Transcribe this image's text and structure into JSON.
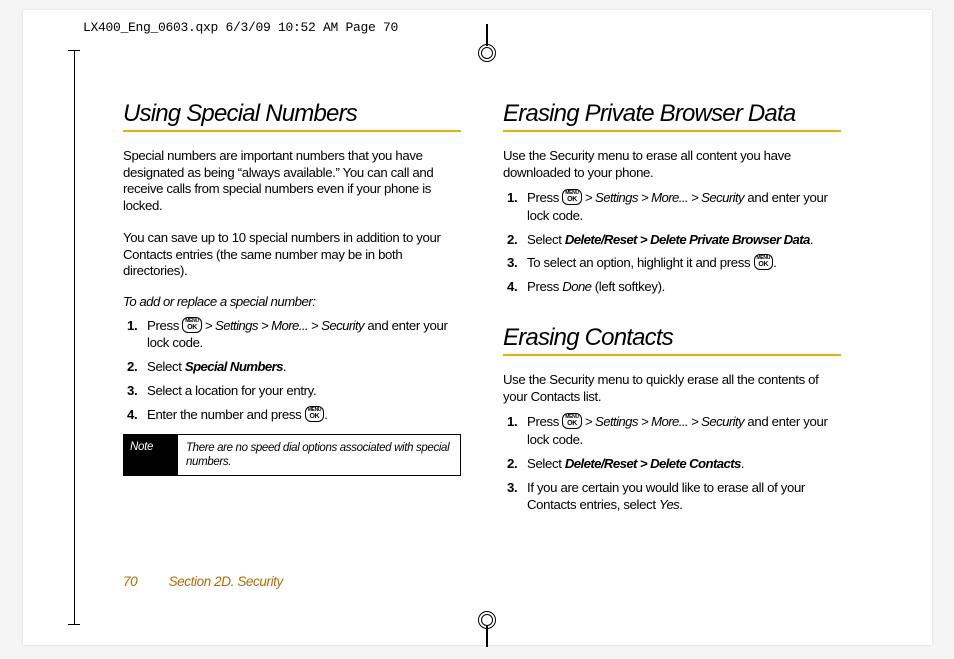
{
  "slug": "LX400_Eng_0603.qxp  6/3/09  10:52 AM  Page 70",
  "ok_key": {
    "top": "MENU",
    "bottom": "OK"
  },
  "left": {
    "heading": "Using Special Numbers",
    "para1": "Special numbers are important numbers that you have designated as being “always available.” You can call and receive calls from special numbers even if your phone is locked.",
    "para2": "You can save up to 10 special numbers in addition to your Contacts entries (the same number may be in both directories).",
    "lead": "To add or replace a special number:",
    "steps": [
      {
        "pre": "Press ",
        "path": " > Settings > More... > Security",
        "post": " and enter your lock code."
      },
      {
        "pre": "Select ",
        "em": "Special Numbers",
        "post": "."
      },
      {
        "plain": "Select a location for your entry."
      },
      {
        "pre": "Enter the number and press ",
        "ok_after": true,
        "post": "."
      }
    ],
    "note_label": "Note",
    "note_text": "There are no speed dial options associated with special numbers."
  },
  "right": {
    "sec1": {
      "heading": "Erasing Private Browser Data",
      "para": "Use the Security menu to erase all content you have downloaded to your phone.",
      "steps": [
        {
          "pre": "Press ",
          "path": " > Settings > More... > Security",
          "post": " and enter your lock code."
        },
        {
          "pre": "Select ",
          "em": "Delete/Reset > Delete Private Browser Data",
          "post": "."
        },
        {
          "pre": "To select an option, highlight it and press ",
          "ok_after": true,
          "post": "."
        },
        {
          "pre": "Press ",
          "em": "Done",
          "post": " (left softkey)."
        }
      ]
    },
    "sec2": {
      "heading": "Erasing Contacts",
      "para": "Use the Security menu to quickly erase all the contents of your Contacts list.",
      "steps": [
        {
          "pre": "Press ",
          "path": " > Settings > More... > Security",
          "post": " and enter your lock code."
        },
        {
          "pre": "Select ",
          "em": "Delete/Reset > Delete Contacts",
          "post": "."
        },
        {
          "pre": "If you are certain you would like to erase all of your Contacts entries, select ",
          "em": "Yes",
          "post": "."
        }
      ]
    }
  },
  "footer": {
    "page": "70",
    "section": "Section 2D. Security"
  }
}
